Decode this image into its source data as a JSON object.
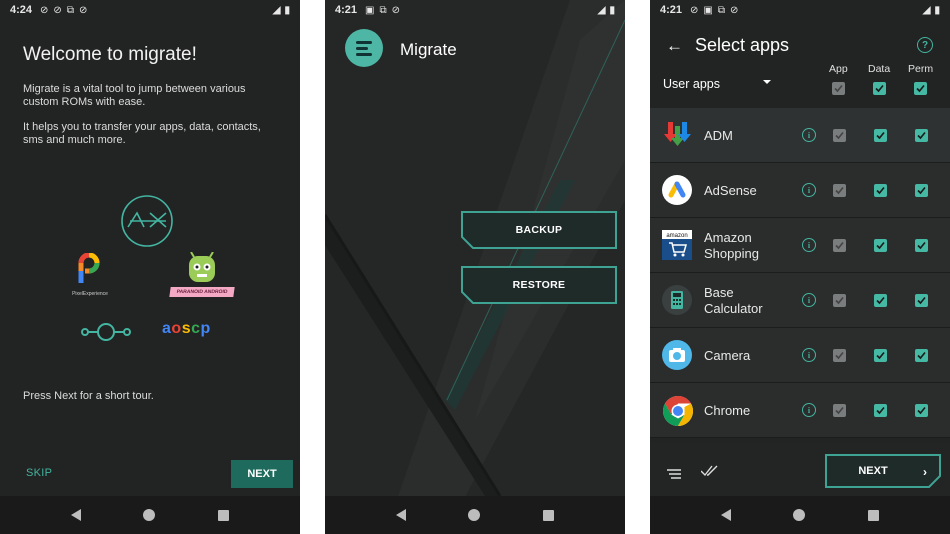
{
  "status_bars": [
    {
      "time": "4:24"
    },
    {
      "time": "4:21"
    },
    {
      "time": "4:21"
    }
  ],
  "welcome": {
    "title": "Welcome to migrate!",
    "para1": "Migrate is a vital tool to jump between various custom ROMs with ease.",
    "para2": "It helps you to transfer your apps, data, contacts, sms and much more.",
    "para3": "Press Next for a short tour.",
    "skip_label": "SKIP",
    "next_label": "NEXT",
    "logos": {
      "pixel_caption": "PixelExperience",
      "aoscp": "aoscp",
      "pe_banner": "PARANOID ANDROID"
    }
  },
  "home": {
    "app_title": "Migrate",
    "backup_label": "BACKUP",
    "restore_label": "RESTORE"
  },
  "select_apps": {
    "title": "Select apps",
    "filter_value": "User apps",
    "columns": [
      "App",
      "Data",
      "Perm"
    ],
    "apps": [
      {
        "name": "ADM",
        "app": true,
        "data": true,
        "perm": true,
        "icon": "adm-download-icon"
      },
      {
        "name": "AdSense",
        "app": true,
        "data": true,
        "perm": true,
        "icon": "adsense-icon"
      },
      {
        "name": "Amazon\nShopping",
        "app": true,
        "data": true,
        "perm": true,
        "icon": "amazon-icon"
      },
      {
        "name": "Base\nCalculator",
        "app": true,
        "data": true,
        "perm": true,
        "icon": "calculator-icon"
      },
      {
        "name": "Camera",
        "app": true,
        "data": true,
        "perm": true,
        "icon": "camera-icon"
      },
      {
        "name": "Chrome",
        "app": true,
        "data": true,
        "perm": true,
        "icon": "chrome-icon"
      }
    ],
    "next_label": "NEXT"
  },
  "colors": {
    "accent": "#46b9a5",
    "background": "#222323",
    "button_dark": "#1e6b5e"
  }
}
